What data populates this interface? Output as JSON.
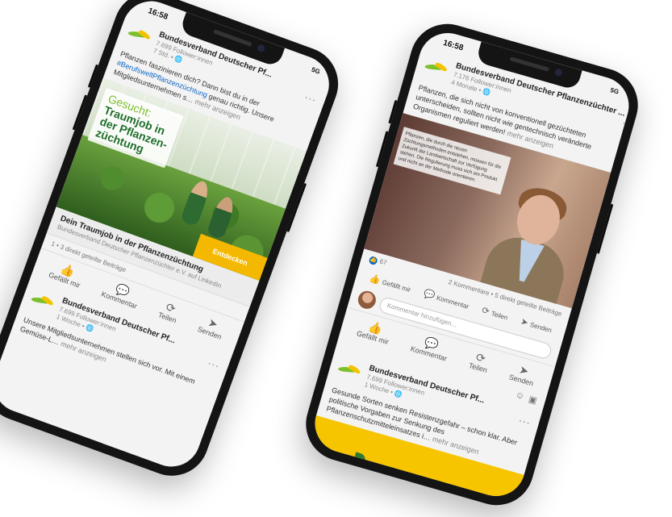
{
  "left_phone": {
    "time": "16:58",
    "network": "5G",
    "post": {
      "org_name": "Bundesverband Deutscher Pf...",
      "followers": "7.699 Follower:innen",
      "age": "7 Std. • 🌐",
      "text_pre": "Pflanzen faszinieren dich? Dann bist du in der ",
      "hashtag": "#BerufsweltPflanzenzüchtung",
      "text_post": " genau richtig. Unsere Mitgliedsunternehmen s…",
      "more": "mehr anzeigen",
      "ad_line1": "Gesucht:",
      "ad_line2": "Traumjob in",
      "ad_line3": "der Pflanzen-",
      "ad_line4": "züchtung",
      "cta": "Entdecken",
      "caption_title": "Dein Traumjob in der Pflanzenzüchtung",
      "caption_source": "Bundesverband Deutscher Pflanzenzüchter e.V. auf LinkedIn",
      "stats": "1 • 3 direkt geteilte Beiträge"
    },
    "actions": [
      "Gefällt mir",
      "Kommentar",
      "Teilen",
      "Senden"
    ],
    "post2": {
      "org_name": "Bundesverband Deutscher Pf...",
      "followers": "7.699 Follower:innen",
      "age": "1 Woche • 🌐",
      "text": "Unsere Mitgliedsunternehmen stellen sich vor. Mit einem Gemüse-L…",
      "more": "mehr anzeigen"
    }
  },
  "right_phone": {
    "time": "16:58",
    "network": "5G",
    "post": {
      "org_name": "Bundesverband Deutscher Pflanzenzüchter ...",
      "followers": "7.176 Follower:innen",
      "age": "4 Monate • 🌐",
      "text": "Pflanzen, die sich nicht von konventionell gezüchteten unterscheiden, sollten nicht wie gentechnisch veränderte Organismen reguliert werden!",
      "more": "mehr anzeigen",
      "overlay_text": "Pflanzen, die durch die neuen Züchtungsmethoden entstehen, müssen für die Zukunft der Landwirtschaft zur Verfügung stehen. Die Regulierung muss sich am Produkt und nicht an der Methode orientieren.",
      "likes": "67",
      "comments": "2 Kommentare • 5 direkt geteilte Beiträge",
      "comment_placeholder": "Kommentar hinzufügen..."
    },
    "small_actions": [
      "Gefällt mir",
      "Kommentar",
      "Teilen",
      "Senden"
    ],
    "actions": [
      "Gefällt mir",
      "Kommentar",
      "Teilen",
      "Senden"
    ],
    "post2": {
      "org_name": "Bundesverband Deutscher Pf...",
      "followers": "7.699 Follower:innen",
      "age": "1 Woche • 🌐",
      "text": "Gesunde Sorten senken Resistenzgefahr – schon klar. Aber politische Vorgaben zur Senkung des Pflanzenschutzmitteleinsatzes i…",
      "more": "mehr anzeigen"
    }
  }
}
